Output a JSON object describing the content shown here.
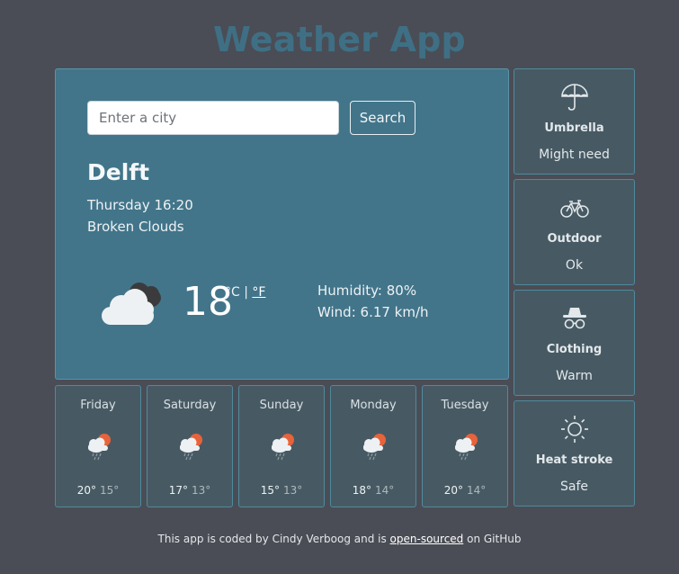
{
  "app": {
    "title": "Weather App"
  },
  "search": {
    "placeholder": "Enter a city",
    "value": "",
    "button_label": "Search"
  },
  "current": {
    "city": "Delft",
    "datetime": "Thursday 16:20",
    "description": "Broken Clouds",
    "icon": "broken-clouds-icon",
    "temperature": "18",
    "unit_c": "°C",
    "unit_sep": " | ",
    "unit_f": "°F",
    "humidity": "Humidity: 80%",
    "wind": "Wind: 6.17 km/h"
  },
  "advice": [
    {
      "icon": "umbrella-icon",
      "title": "Umbrella",
      "value": "Might need"
    },
    {
      "icon": "bicycle-icon",
      "title": "Outdoor",
      "value": "Ok"
    },
    {
      "icon": "spy-hat-glasses-icon",
      "title": "Clothing",
      "value": "Warm"
    },
    {
      "icon": "sun-icon",
      "title": "Heat stroke",
      "value": "Safe"
    }
  ],
  "forecast": [
    {
      "day": "Friday",
      "icon": "sun-cloud-rain-icon",
      "max": "20°",
      "min": "15°"
    },
    {
      "day": "Saturday",
      "icon": "sun-cloud-rain-icon",
      "max": "17°",
      "min": "13°"
    },
    {
      "day": "Sunday",
      "icon": "sun-cloud-rain-icon",
      "max": "15°",
      "min": "13°"
    },
    {
      "day": "Monday",
      "icon": "sun-cloud-rain-icon",
      "max": "18°",
      "min": "14°"
    },
    {
      "day": "Tuesday",
      "icon": "sun-cloud-rain-icon",
      "max": "20°",
      "min": "14°"
    }
  ],
  "footer": {
    "text_before": "This app is coded by Cindy Verboog and is ",
    "link": "open-sourced",
    "text_after": " on GitHub"
  },
  "colors": {
    "background": "#4a4d55",
    "title": "#3f6f84",
    "main_card": "#42758a",
    "side_card": "#475a64",
    "sun": "#e8633a"
  }
}
